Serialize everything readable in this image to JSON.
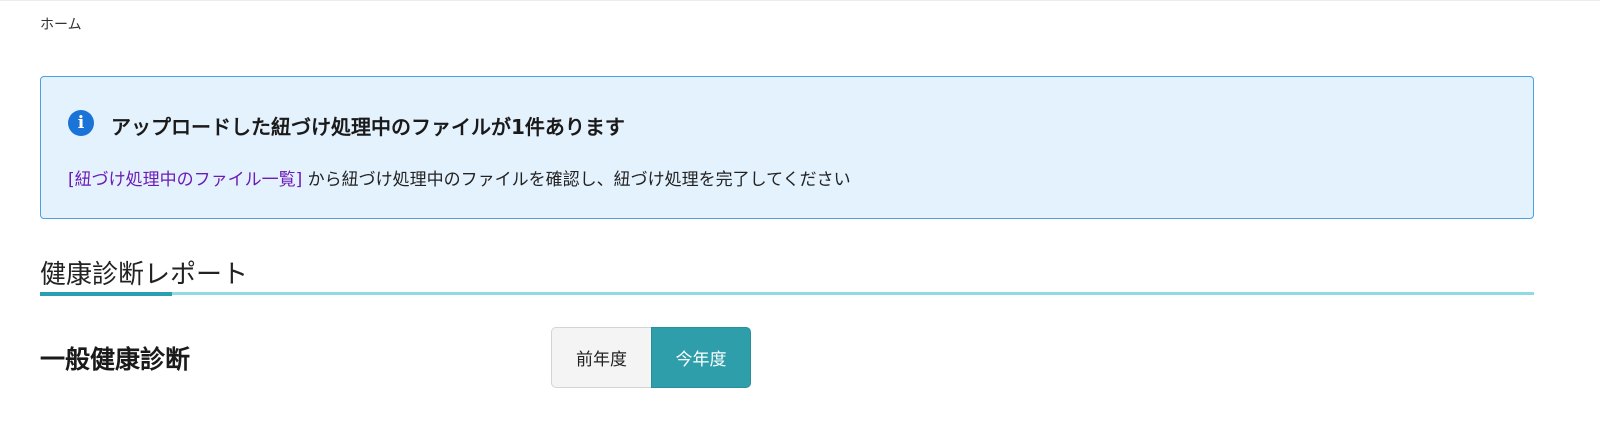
{
  "breadcrumb": {
    "home_label": "ホーム"
  },
  "alert": {
    "icon": "info-icon",
    "icon_glyph": "i",
    "title": "アップロードした紐づけ処理中のファイルが1件あります",
    "link_label": "[紐づけ処理中のファイル一覧]",
    "body_text": " から紐づけ処理中のファイルを確認し、紐づけ処理を完了してください"
  },
  "section": {
    "title": "健康診断レポート"
  },
  "subsection": {
    "title": "一般健康診断"
  },
  "year_toggle": {
    "prev_label": "前年度",
    "current_label": "今年度",
    "selected": "今年度"
  },
  "colors": {
    "alert_background": "#e4f2fd",
    "alert_border": "#4aa0e3",
    "info_icon": "#1a73d6",
    "link": "#6a1bb8",
    "section_rule": "#8fdbe3",
    "section_accent": "#2a9fb2",
    "selected_toggle": "#2e9eab"
  }
}
